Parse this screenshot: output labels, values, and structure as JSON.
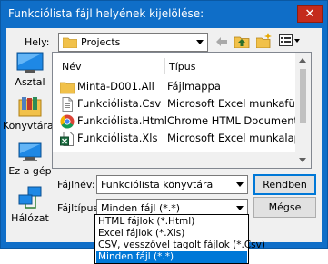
{
  "window": {
    "title": "Funkciólista fájl helyének kijelölése:",
    "close_glyph": "✕"
  },
  "location": {
    "label": "Hely:",
    "value": "Projects",
    "icon": "folder-icon"
  },
  "toolbar": {
    "icons": [
      "back-arrow-icon",
      "up-folder-icon",
      "new-folder-icon",
      "view-menu-icon"
    ]
  },
  "places": [
    {
      "label": "Asztal",
      "icon": "desktop-icon"
    },
    {
      "label": "Könyvtárak",
      "icon": "libraries-icon"
    },
    {
      "label": "Ez a gép",
      "icon": "computer-icon"
    },
    {
      "label": "Hálózat",
      "icon": "network-icon"
    }
  ],
  "file_list": {
    "columns": [
      "Név",
      "Típus"
    ],
    "rows": [
      {
        "name": "Minta-D001.All",
        "type": "Fájlmappa",
        "icon": "folder-icon"
      },
      {
        "name": "Funkciólista.Csv",
        "type": "Microsoft Excel munkafüzet",
        "icon": "csv-file-icon"
      },
      {
        "name": "Funkciólista.Html",
        "type": "Chrome HTML Document",
        "icon": "chrome-icon"
      },
      {
        "name": "Funkciólista.Xls",
        "type": "Microsoft Excel munkalap",
        "icon": "excel-file-icon"
      }
    ]
  },
  "filename": {
    "label": "Fájlnév:",
    "value": "Funkciólista könyvtára"
  },
  "filetype": {
    "label": "Fájltípus:",
    "value": "Minden fájl (*.*)",
    "options": [
      "HTML fájlok (*.Html)",
      "Excel fájlok (*.Xls)",
      "CSV, vesszővel tagolt fájlok (*.Csv)",
      "Minden fájl (*.*)"
    ],
    "selected_index": 3
  },
  "buttons": {
    "ok": "Rendben",
    "cancel": "Mégse"
  },
  "colors": {
    "titlebar": "#0f6ec8",
    "close": "#c42b1c",
    "selection": "#0078d7",
    "folder": "#f1c14a"
  }
}
